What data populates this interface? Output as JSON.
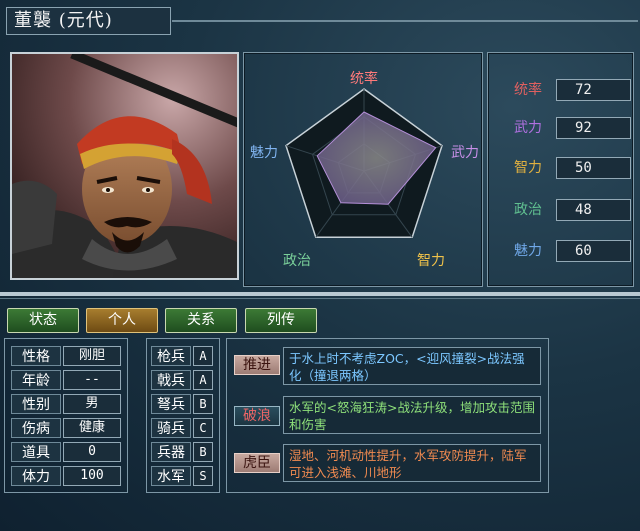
{
  "general": {
    "name": "董襲 (元代)"
  },
  "radar": {
    "labels": {
      "top": "统率",
      "right": "武力",
      "bottom_right": "智力",
      "bottom_left": "政治",
      "left": "魅力"
    }
  },
  "stats": [
    {
      "label": "统率",
      "value": "72",
      "color": "#e06060"
    },
    {
      "label": "武力",
      "value": "92",
      "color": "#b070e0"
    },
    {
      "label": "智力",
      "value": "50",
      "color": "#e0b040"
    },
    {
      "label": "政治",
      "value": "48",
      "color": "#60c090"
    },
    {
      "label": "魅力",
      "value": "60",
      "color": "#70a8e8"
    }
  ],
  "tabs": [
    {
      "label": "状态",
      "active": false
    },
    {
      "label": "个人",
      "active": true
    },
    {
      "label": "关系",
      "active": false
    },
    {
      "label": "列传",
      "active": false
    }
  ],
  "personal": [
    {
      "label": "性格",
      "value": "刚胆"
    },
    {
      "label": "年龄",
      "value": "--"
    },
    {
      "label": "性别",
      "value": "男"
    },
    {
      "label": "伤病",
      "value": "健康"
    },
    {
      "label": "道具",
      "value": "0"
    },
    {
      "label": "体力",
      "value": "100"
    }
  ],
  "troops": [
    {
      "label": "枪兵",
      "value": "A"
    },
    {
      "label": "戟兵",
      "value": "A"
    },
    {
      "label": "弩兵",
      "value": "B"
    },
    {
      "label": "骑兵",
      "value": "C"
    },
    {
      "label": "兵器",
      "value": "B"
    },
    {
      "label": "水军",
      "value": "S"
    }
  ],
  "skills": [
    {
      "name": "推进",
      "desc": "于水上时不考虑ZOC，<迎风撞裂>战法强化（撞退两格）",
      "desc_color": "#7cc7ff"
    },
    {
      "name": "破浪",
      "desc": "水军的<怒海狂涛>战法升级，增加攻击范围和伤害",
      "desc_color": "#8ee07a"
    },
    {
      "name": "虎臣",
      "desc": "湿地、河机动性提升，水军攻防提升，陆军可进入浅滩、川地形",
      "desc_color": "#f08a50"
    }
  ]
}
